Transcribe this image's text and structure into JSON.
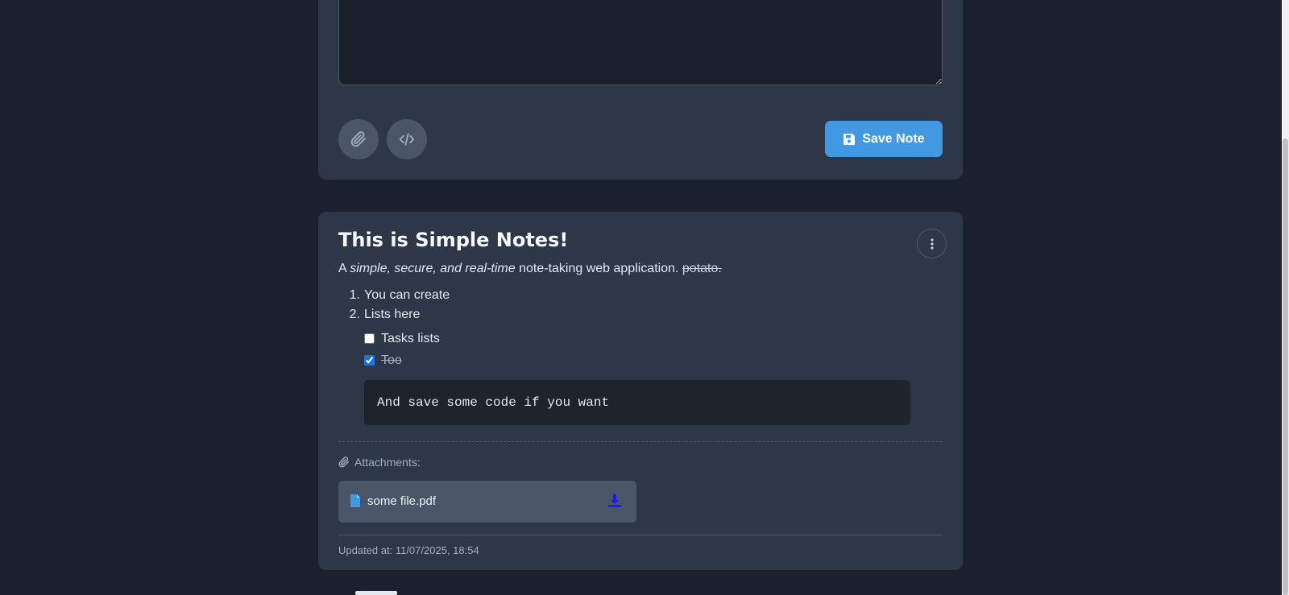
{
  "composer": {
    "textarea_value": "",
    "attach_icon": "paperclip-icon",
    "code_icon": "code-icon",
    "save_label": "Save Note",
    "save_icon": "floppy-disk-icon"
  },
  "note": {
    "title": "This is Simple Notes!",
    "intro": {
      "prefix": "A ",
      "italic": "simple, secure, and real-time",
      "middle": " note-taking web application. ",
      "strike": "potato."
    },
    "list": [
      {
        "num": "1.",
        "text": "You can create"
      },
      {
        "num": "2.",
        "text": "Lists here"
      }
    ],
    "tasks": [
      {
        "text": "Tasks lists",
        "checked": false
      },
      {
        "text": "Too",
        "checked": true
      }
    ],
    "code": "And save some code if you want",
    "attachments_label": "Attachments:",
    "attachment": {
      "filename": "some file.pdf",
      "file_icon": "file-icon",
      "download_icon": "download-icon"
    },
    "updated": "Updated at: 11/07/2025, 18:54",
    "menu_icon": "kebab-menu-icon"
  },
  "colors": {
    "background": "#1a202c",
    "card": "#2d3748",
    "accent": "#4299e1",
    "download": "#1a1aff"
  }
}
